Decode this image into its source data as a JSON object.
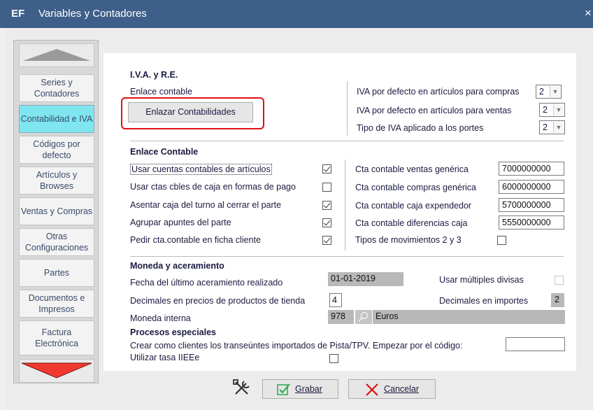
{
  "window": {
    "app_badge": "EF",
    "title": "Variables y Contadores",
    "close_glyph": "×"
  },
  "sidebar": {
    "items": [
      {
        "label": "Series y Contadores"
      },
      {
        "label": "Contabilidad e IVA",
        "active": true
      },
      {
        "label": "Códigos por defecto"
      },
      {
        "label": "Artículos y Browses"
      },
      {
        "label": "Ventas y Compras"
      },
      {
        "label": "Otras Configuraciones"
      },
      {
        "label": "Partes"
      },
      {
        "label": "Documentos e Impresos"
      },
      {
        "label": "Factura Electrónica"
      }
    ]
  },
  "iva": {
    "heading": "I.V.A. y R.E.",
    "link_label": "Enlace contable",
    "link_button": "Enlazar Contabilidades",
    "purchase_label": "IVA por defecto en artículos para compras",
    "purchase_value": "2",
    "sales_label": "IVA por defecto en artículos para ventas",
    "sales_value": "2",
    "shipping_label": "Tipo de IVA aplicado a los portes",
    "shipping_value": "2"
  },
  "enlace": {
    "heading": "Enlace Contable",
    "options": [
      {
        "label": "Usar cuentas contables de artículos",
        "checked": true
      },
      {
        "label": "Usar ctas cbles de caja en formas de pago",
        "checked": false
      },
      {
        "label": "Asentar caja del turno al cerrar el parte",
        "checked": true
      },
      {
        "label": "Agrupar apuntes del parte",
        "checked": true
      },
      {
        "label": "Pedir cta.contable en ficha cliente",
        "checked": true
      }
    ],
    "accounts": [
      {
        "label": "Cta contable ventas genérica",
        "value": "7000000000"
      },
      {
        "label": "Cta contable compras genérica",
        "value": "6000000000"
      },
      {
        "label": "Cta contable caja expendedor",
        "value": "5700000000"
      },
      {
        "label": "Cta contable diferencias caja",
        "value": "5550000000"
      }
    ],
    "movements_label": "Tipos de movimientos 2 y 3",
    "movements_checked": false
  },
  "moneda": {
    "heading": "Moneda y aceramiento",
    "last_date_label": "Fecha del último aceramiento realizado",
    "last_date_value": "01-01-2019",
    "multi_currency_label": "Usar múltiples divisas",
    "decimals_products_label": "Decimales en precios de productos de tienda",
    "decimals_products_value": "4",
    "decimals_amounts_label": "Decimales en importes",
    "decimals_amounts_value": "2",
    "internal_currency_label": "Moneda interna",
    "internal_currency_code": "978",
    "internal_currency_name": "Euros"
  },
  "procesos": {
    "heading": "Procesos especiales",
    "transients_label": "Crear como clientes los transeúntes importados de Pista/TPV. Empezar por el código:",
    "transients_value": "",
    "ieee_label": "Utilizar tasa IIEEe",
    "ieee_checked": false
  },
  "footer": {
    "save_label": "Grabar",
    "cancel_label": "Cancelar"
  },
  "colors": {
    "titlebar": "#3d5f8a",
    "active_tab": "#7fe6ef",
    "highlight": "#e01010",
    "save_icon": "#2aa84a",
    "cancel_icon": "#e01010"
  }
}
